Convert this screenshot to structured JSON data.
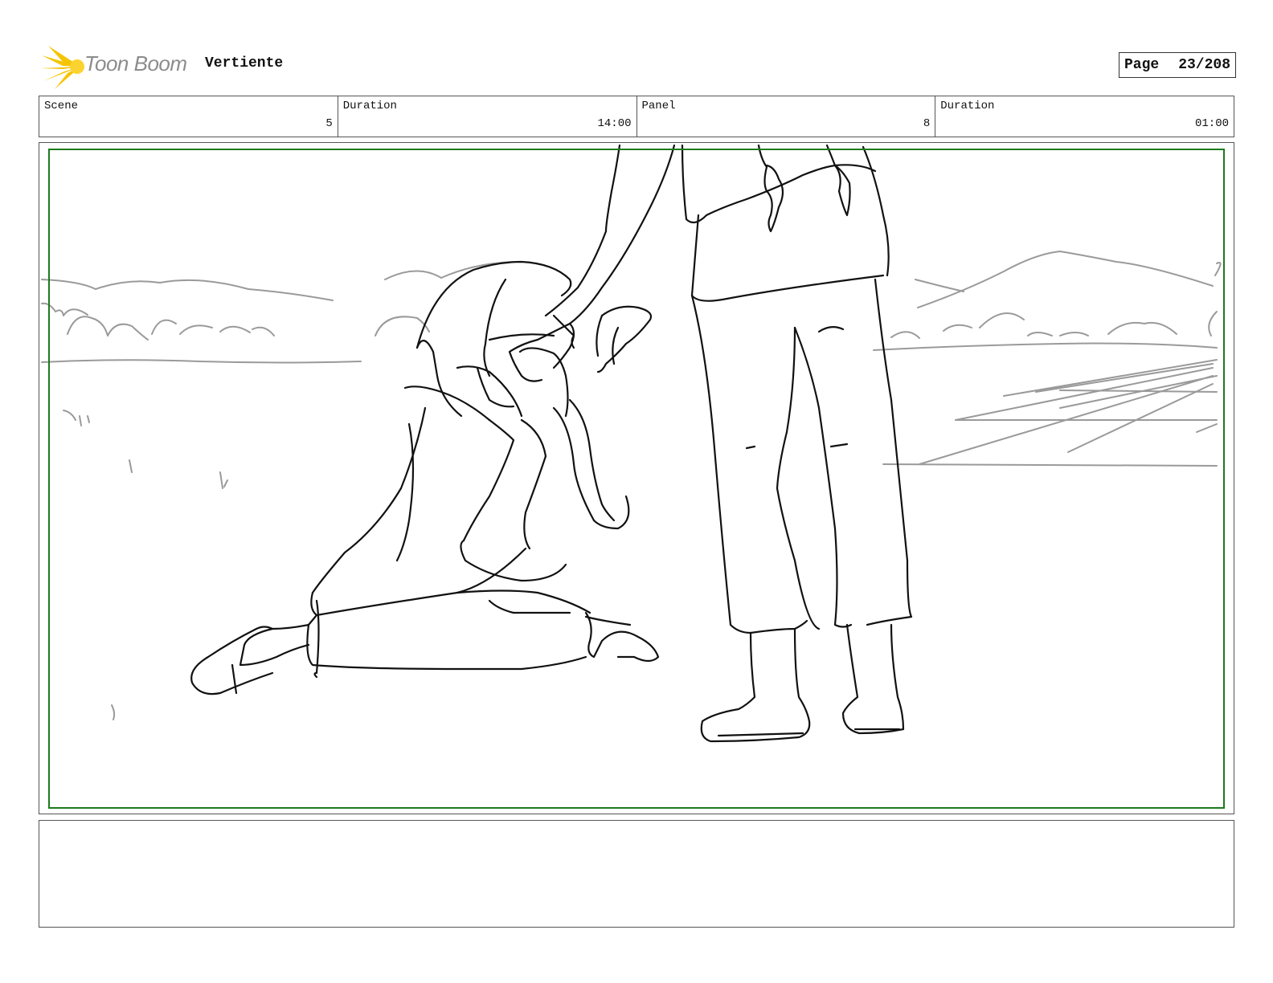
{
  "header": {
    "logo_text": "Toon Boom",
    "project_title": "Vertiente",
    "page_label": "Page",
    "page_number": "23/208"
  },
  "info": {
    "scene_label": "Scene",
    "scene_value": "5",
    "scene_duration_label": "Duration",
    "scene_duration_value": "14:00",
    "panel_label": "Panel",
    "panel_value": "8",
    "panel_duration_label": "Duration",
    "panel_duration_value": "01:00"
  },
  "colors": {
    "safe_frame": "#1e7a1e",
    "logo_accent": "#f5c400",
    "sketch_line": "#111111",
    "background_line": "#9a9a9a"
  },
  "notes": {
    "text": ""
  }
}
